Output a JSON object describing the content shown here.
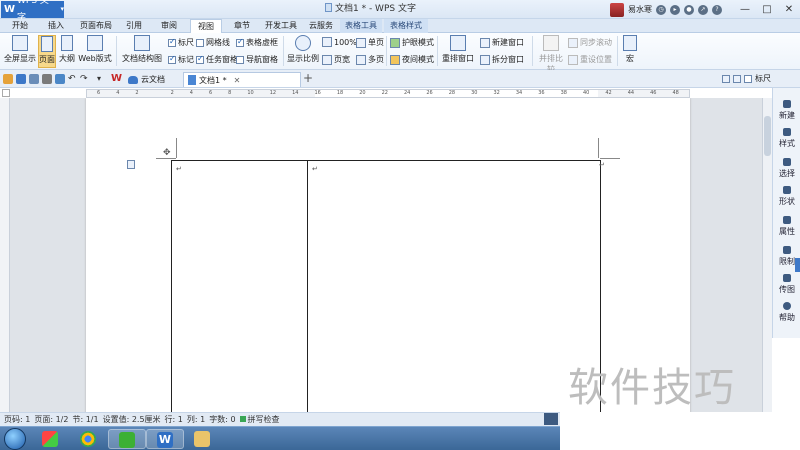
{
  "titlebar": {
    "app_button_logo": "W",
    "app_button_label": "WPS 文字",
    "window_title": "文档1 * - WPS 文字",
    "user_name": "易水寒",
    "controls": [
      "—",
      "□",
      "✕"
    ]
  },
  "menu_tabs": [
    "开始",
    "插入",
    "页面布局",
    "引用",
    "审阅",
    "视图",
    "章节",
    "开发工具",
    "云服务",
    "表格工具",
    "表格样式"
  ],
  "active_tab": "视图",
  "ribbon": {
    "view_buttons": [
      "全屏显示",
      "页面",
      "大纲",
      "Web版式"
    ],
    "doc_structure": "文档结构图",
    "checkboxes": [
      {
        "label": "标尺",
        "checked": true
      },
      {
        "label": "网格线",
        "checked": false
      },
      {
        "label": "表格虚框",
        "checked": true
      },
      {
        "label": "标记",
        "checked": true
      },
      {
        "label": "任务窗格",
        "checked": true
      },
      {
        "label": "导航窗格",
        "checked": false
      }
    ],
    "zoom_label": "显示比例",
    "zoom_value": "100%",
    "single_page": "单页",
    "page_width": "页宽",
    "multi_page": "多页",
    "eye_protect": "护眼模式",
    "night_mode": "夜间模式",
    "rearrange": "重排窗口",
    "new_window": "新建窗口",
    "split_window": "拆分窗口",
    "side_by_side": "并排比较",
    "sync_scroll": "同步滚动",
    "reset_position": "重设位置",
    "macro": "宏"
  },
  "doc_tabs": {
    "cloud": "云文档",
    "doc": "文档1 *",
    "ruler_label": "标尺"
  },
  "ruler_numbers": [
    "6",
    "4",
    "2",
    "",
    "2",
    "4",
    "6",
    "8",
    "10",
    "12",
    "14",
    "16",
    "18",
    "20",
    "22",
    "24",
    "26",
    "28",
    "30",
    "32",
    "34",
    "36",
    "38",
    "40",
    "42",
    "44",
    "46",
    "48"
  ],
  "task_pane": [
    "新建",
    "样式",
    "选择",
    "形状",
    "属性",
    "限制",
    "传图",
    "帮助"
  ],
  "statusbar": {
    "page_no": "页码: 1",
    "pages": "页面: 1/2",
    "section": "节: 1/1",
    "setting": "设置值: 2.5厘米",
    "row": "行: 1",
    "col": "列: 1",
    "word_count": "字数: 0",
    "spell_check": "拼写检查"
  },
  "watermark": "软件技巧",
  "paragraph_mark": "↵"
}
